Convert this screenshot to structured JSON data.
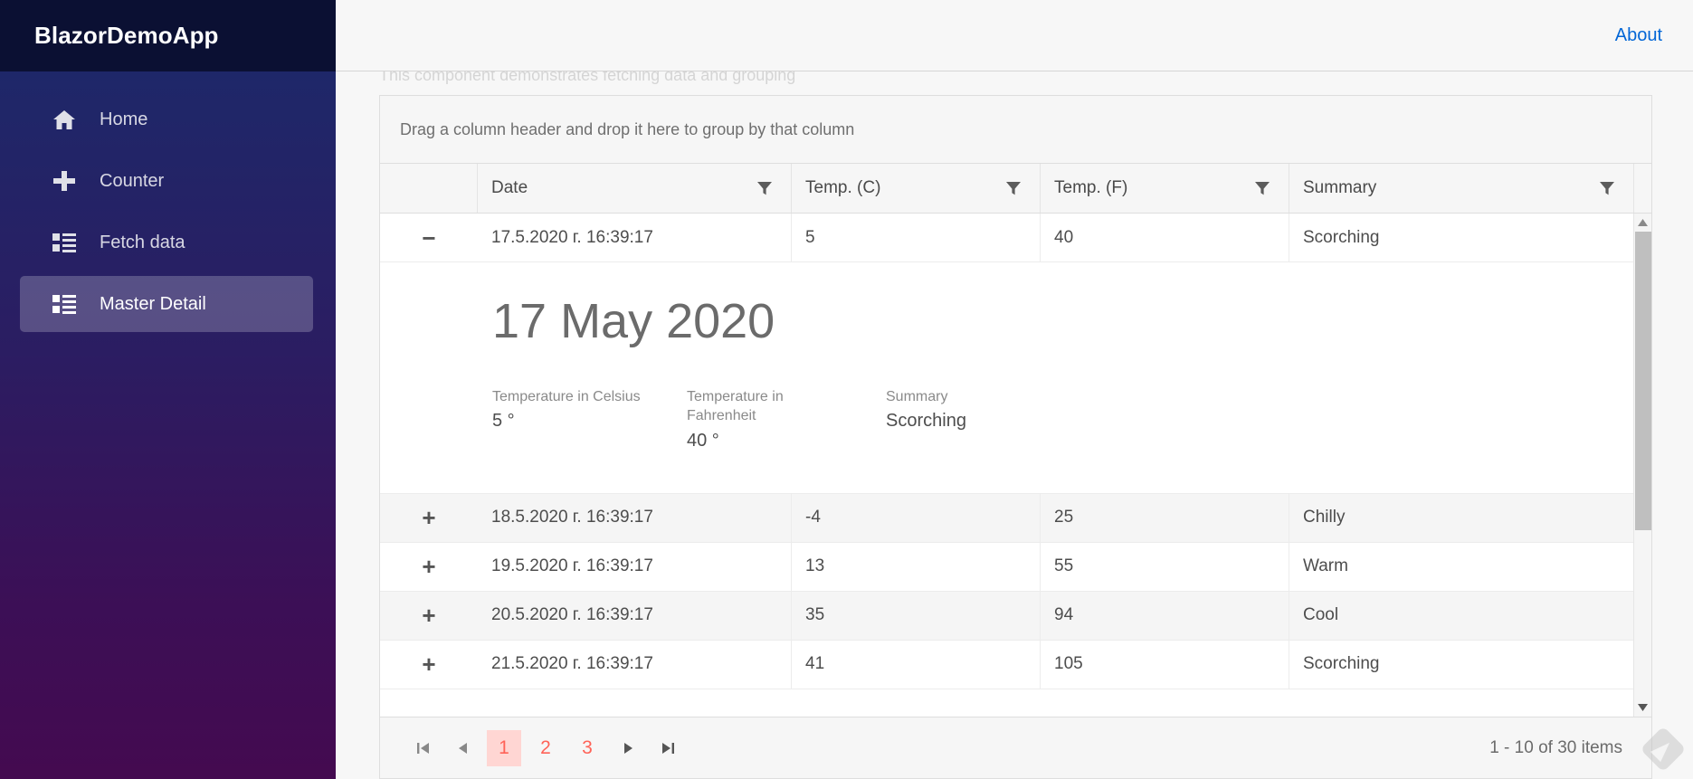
{
  "app": {
    "brand": "BlazorDemoApp",
    "about_label": "About"
  },
  "sidebar": {
    "items": [
      {
        "label": "Home",
        "icon": "home-icon",
        "active": false
      },
      {
        "label": "Counter",
        "icon": "plus-icon",
        "active": false
      },
      {
        "label": "Fetch data",
        "icon": "list-icon",
        "active": false
      },
      {
        "label": "Master Detail",
        "icon": "list-icon",
        "active": true
      }
    ]
  },
  "page": {
    "intro_clipped": "This component demonstrates fetching data and grouping"
  },
  "grid": {
    "group_panel_text": "Drag a column header and drop it here to group by that column",
    "columns": [
      {
        "key": "date",
        "label": "Date",
        "filter_icon": "filter-icon"
      },
      {
        "key": "tempC",
        "label": "Temp. (C)",
        "filter_icon": "filter-icon"
      },
      {
        "key": "tempF",
        "label": "Temp. (F)",
        "filter_icon": "filter-icon"
      },
      {
        "key": "summary",
        "label": "Summary",
        "filter_icon": "filter-icon"
      }
    ],
    "rows": [
      {
        "expander": "−",
        "expanded": true,
        "date": "17.5.2020 г. 16:39:17",
        "tempC": "5",
        "tempF": "40",
        "summary": "Scorching"
      },
      {
        "expander": "+",
        "expanded": false,
        "date": "18.5.2020 г. 16:39:17",
        "tempC": "-4",
        "tempF": "25",
        "summary": "Chilly"
      },
      {
        "expander": "+",
        "expanded": false,
        "date": "19.5.2020 г. 16:39:17",
        "tempC": "13",
        "tempF": "55",
        "summary": "Warm"
      },
      {
        "expander": "+",
        "expanded": false,
        "date": "20.5.2020 г. 16:39:17",
        "tempC": "35",
        "tempF": "94",
        "summary": "Cool"
      },
      {
        "expander": "+",
        "expanded": false,
        "date": "21.5.2020 г. 16:39:17",
        "tempC": "41",
        "tempF": "105",
        "summary": "Scorching"
      }
    ],
    "detail": {
      "title": "17 May 2020",
      "fields": [
        {
          "label": "Temperature in Celsius",
          "value": "5 °"
        },
        {
          "label": "Temperature in Fahrenheit",
          "value": "40 °"
        },
        {
          "label": "Summary",
          "value": "Scorching"
        }
      ]
    }
  },
  "pager": {
    "first_icon": "first-page-icon",
    "prev_icon": "prev-page-icon",
    "next_icon": "next-page-icon",
    "last_icon": "last-page-icon",
    "pages": [
      "1",
      "2",
      "3"
    ],
    "current_page": "1",
    "summary": "1 - 10 of 30 items"
  },
  "colors": {
    "accent": "#ff6358",
    "accent_bg": "#ffd6d3",
    "brand_bar": "#0b1033",
    "link": "#0366d6"
  }
}
